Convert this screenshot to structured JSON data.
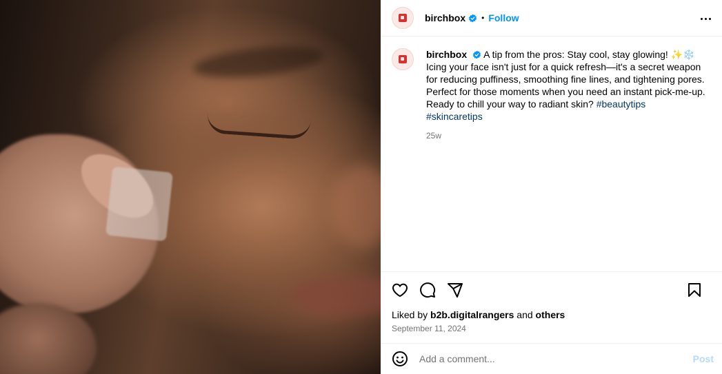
{
  "post": {
    "username": "birchbox",
    "follow_label": "Follow",
    "separator": "•",
    "caption_user": "birchbox",
    "caption_text": " A tip from the pros: Stay cool, stay glowing! ✨❄️ Icing your face isn't just for a quick refresh—it's a secret weapon for reducing puffiness, smoothing fine lines, and tightening pores. Perfect for those moments when you need an instant pick-me-up. Ready to chill your way to radiant skin? ",
    "hashtag_1": "#beautytips",
    "hashtag_2": "#skincaretips",
    "time_ago": "25w"
  },
  "engagement": {
    "liked_prefix": "Liked by ",
    "liked_user": "b2b.digitalrangers",
    "liked_middle": " and ",
    "liked_others": "others",
    "date": "September 11, 2024"
  },
  "comment": {
    "placeholder": "Add a comment...",
    "post_label": "Post"
  },
  "icons": {
    "verified": "verified-badge-icon",
    "more": "more-options-icon",
    "like": "heart-icon",
    "comment": "comment-icon",
    "share": "share-icon",
    "save": "bookmark-icon",
    "emoji": "emoji-icon"
  },
  "colors": {
    "accent": "#0095f6",
    "hashtag": "#00376b",
    "brand": "#d9302f",
    "muted": "#737373",
    "post_disabled": "#b3dbff"
  }
}
